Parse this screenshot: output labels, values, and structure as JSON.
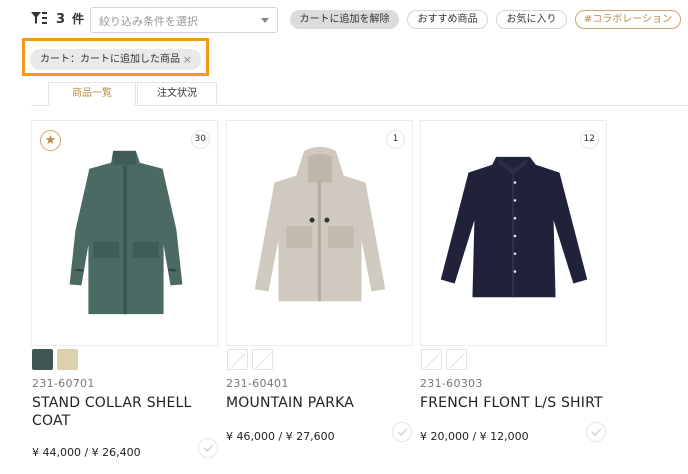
{
  "toolbar": {
    "count": "3",
    "count_unit": "件",
    "filter_placeholder": "絞り込み条件を選択",
    "pills": {
      "clear_cart": "カートに追加を解除",
      "recommended": "おすすめ商品",
      "favorites": "お気に入り",
      "collaboration": "#コラボレーション"
    },
    "active_filter": "カート：カートに追加した商品",
    "active_filter_remove": "×"
  },
  "tabs": [
    "商品一覧",
    "注文状況"
  ],
  "colors": {
    "accent": "#b98c47",
    "highlight": "#f39a1d"
  },
  "products": [
    {
      "badge": "30",
      "favorite_icon": "star-icon",
      "swatches": [
        "#3e5752",
        "#ddd0ad"
      ],
      "code": "231-60701",
      "name": "STAND COLLAR SHELL COAT",
      "price": "¥ 44,000 / ¥ 26,400"
    },
    {
      "badge": "1",
      "code": "231-60401",
      "name": "MOUNTAIN PARKA",
      "price": "¥ 46,000 / ¥ 27,600"
    },
    {
      "badge": "12",
      "code": "231-60303",
      "name": "FRENCH FLONT L/S SHIRT",
      "price": "¥ 20,000 / ¥ 12,000"
    }
  ]
}
